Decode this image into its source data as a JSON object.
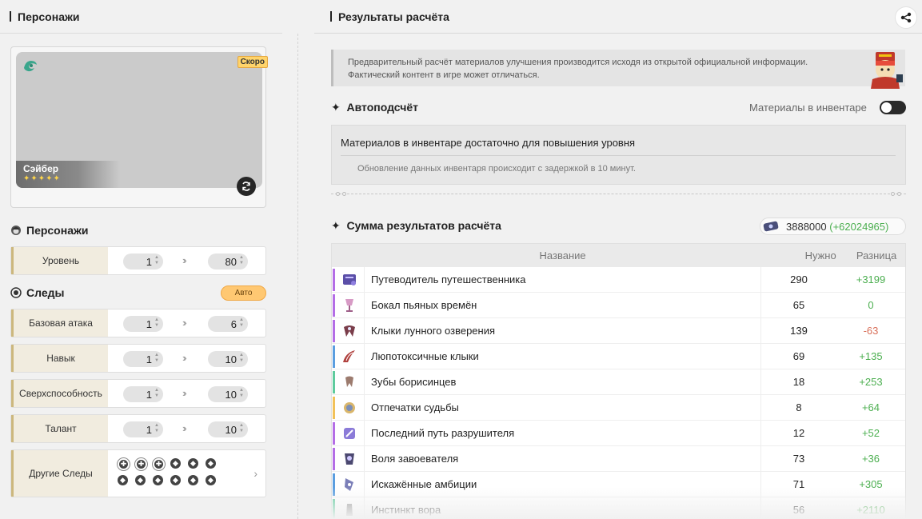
{
  "left_panel": {
    "title": "Персонажи",
    "character": {
      "name": "Сэйбер",
      "stars": "✦✦✦✦✦",
      "badge": "Скоро"
    },
    "characters_section": {
      "title": "Персонажи",
      "level_row": {
        "label": "Уровень",
        "from": "1",
        "to": "80"
      }
    },
    "traces_section": {
      "title": "Следы",
      "auto_label": "Авто",
      "rows": [
        {
          "label": "Базовая атака",
          "from": "1",
          "to": "6"
        },
        {
          "label": "Навык",
          "from": "1",
          "to": "10"
        },
        {
          "label": "Сверхспособность",
          "from": "1",
          "to": "10"
        },
        {
          "label": "Талант",
          "from": "1",
          "to": "10"
        }
      ],
      "other_traces_label": "Другие Следы"
    }
  },
  "right_panel": {
    "title": "Результаты расчёта",
    "notice": {
      "line1": "Предварительный расчёт материалов улучшения производится исходя из открытой официальной информации.",
      "line2": "Фактический контент в игре может отличаться."
    },
    "auto_calc": {
      "title": "Автоподсчёт",
      "inventory_toggle_label": "Материалы в инвентаре",
      "status": "Материалов в инвентаре достаточно для повышения уровня",
      "note": "Обновление данных инвентаря происходит с задержкой в 10 минут."
    },
    "summary": {
      "title": "Сумма результатов расчёта",
      "credits": "3888000",
      "credits_diff": "(+62024965)"
    },
    "table": {
      "headers": {
        "name": "Название",
        "need": "Нужно",
        "diff": "Разница"
      },
      "rows": [
        {
          "name": "Путеводитель путешественника",
          "need": "290",
          "diff": "+3199",
          "rarity_color": "#b46ee6",
          "icon": "guide-book-icon",
          "sign": "pos"
        },
        {
          "name": "Бокал пьяных времён",
          "need": "65",
          "diff": "0",
          "rarity_color": "#b46ee6",
          "icon": "goblet-icon",
          "sign": "pos"
        },
        {
          "name": "Клыки лунного озверения",
          "need": "139",
          "diff": "-63",
          "rarity_color": "#b46ee6",
          "icon": "fang-icon",
          "sign": "neg"
        },
        {
          "name": "Люпотоксичные клыки",
          "need": "69",
          "diff": "+135",
          "rarity_color": "#5b9ee0",
          "icon": "claw-icon",
          "sign": "pos"
        },
        {
          "name": "Зубы борисинцев",
          "need": "18",
          "diff": "+253",
          "rarity_color": "#5fcb9e",
          "icon": "tooth-icon",
          "sign": "pos"
        },
        {
          "name": "Отпечатки судьбы",
          "need": "8",
          "diff": "+64",
          "rarity_color": "#f2c25a",
          "icon": "imprint-icon",
          "sign": "pos"
        },
        {
          "name": "Последний путь разрушителя",
          "need": "12",
          "diff": "+52",
          "rarity_color": "#b46ee6",
          "icon": "path-icon",
          "sign": "pos"
        },
        {
          "name": "Воля завоевателя",
          "need": "73",
          "diff": "+36",
          "rarity_color": "#b46ee6",
          "icon": "will-icon",
          "sign": "pos"
        },
        {
          "name": "Искажённые амбиции",
          "need": "71",
          "diff": "+305",
          "rarity_color": "#5b9ee0",
          "icon": "ambition-icon",
          "sign": "pos"
        },
        {
          "name": "Инстинкт вора",
          "need": "56",
          "diff": "+2110",
          "rarity_color": "#5fcb9e",
          "icon": "instinct-icon",
          "sign": "pos"
        }
      ]
    }
  }
}
